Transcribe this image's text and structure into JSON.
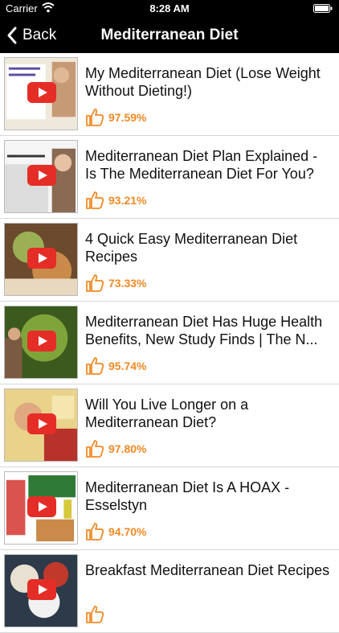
{
  "status_bar": {
    "carrier": "Carrier",
    "time": "8:28 AM"
  },
  "nav": {
    "back_label": "Back",
    "title": "Mediterranean Diet"
  },
  "videos": [
    {
      "title": "My Mediterranean Diet (Lose Weight Without Dieting!)",
      "rating": "97.59%"
    },
    {
      "title": "Mediterranean Diet Plan Explained - Is The Mediterranean Diet For You?",
      "rating": "93.21%"
    },
    {
      "title": "4 Quick Easy Mediterranean Diet Recipes",
      "rating": "73.33%"
    },
    {
      "title": "Mediterranean Diet Has Huge Health Benefits, New Study Finds | The N...",
      "rating": "95.74%"
    },
    {
      "title": "Will You Live Longer on a Mediterranean Diet?",
      "rating": "97.80%"
    },
    {
      "title": "Mediterranean Diet Is A HOAX - Esselstyn",
      "rating": "94.70%"
    },
    {
      "title": "Breakfast Mediterranean Diet Recipes",
      "rating": ""
    }
  ],
  "colors": {
    "accent": "#f08a24",
    "nav_bg": "#000000",
    "play_red": "#e52d27"
  },
  "icons": {
    "back": "chevron-left-icon",
    "rating": "thumbs-up-icon",
    "play": "play-button-icon"
  }
}
